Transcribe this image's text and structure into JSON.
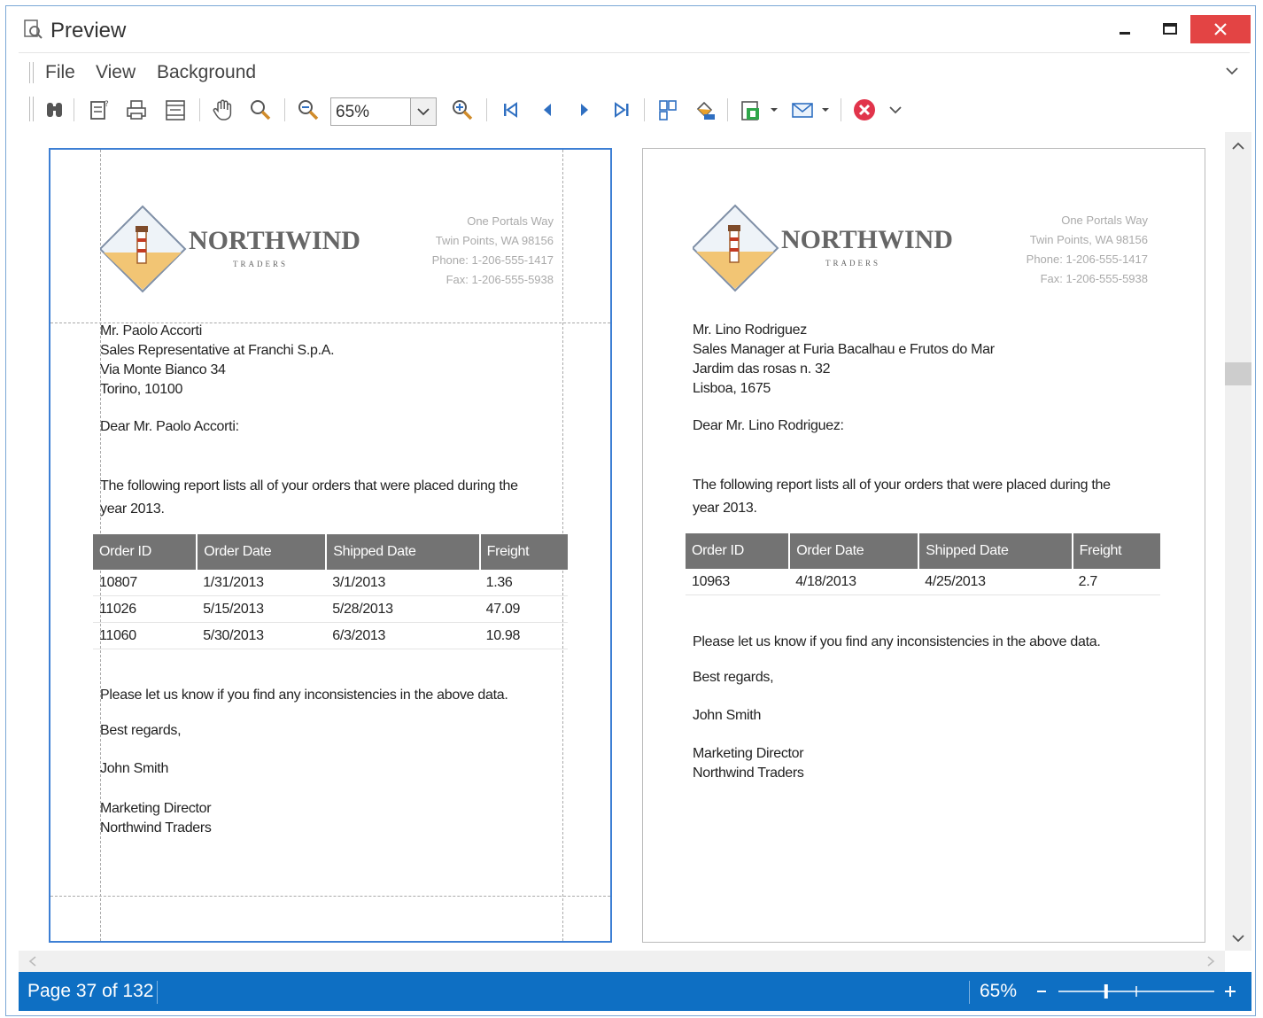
{
  "window": {
    "title": "Preview",
    "minimize_icon": "minimize-icon",
    "maximize_icon": "maximize-icon",
    "close_icon": "close-icon"
  },
  "menu": {
    "items": [
      {
        "label": "File"
      },
      {
        "label": "View"
      },
      {
        "label": "Background"
      }
    ]
  },
  "toolbar": {
    "zoom_value": "65%",
    "icons": [
      "find-icon",
      "open-icon",
      "print-icon",
      "page-setup-icon",
      "hand-tool-icon",
      "magnifier-icon",
      "zoom-out-icon",
      "zoom-in-icon",
      "first-page-icon",
      "previous-page-icon",
      "next-page-icon",
      "last-page-icon",
      "multiple-pages-icon",
      "background-color-icon",
      "export-icon",
      "send-email-icon",
      "close-preview-icon"
    ]
  },
  "pages": [
    {
      "company": {
        "name": "NORTHWIND",
        "tagline": "TRADERS"
      },
      "address": [
        "One Portals Way",
        "Twin Points, WA 98156",
        "Phone: 1-206-555-1417",
        "Fax: 1-206-555-5938"
      ],
      "recipient": [
        "Mr. Paolo Accorti",
        "Sales Representative at Franchi S.p.A.",
        "Via Monte Bianco 34",
        "Torino, 10100"
      ],
      "greeting": "Dear Mr. Paolo Accorti:",
      "intro": [
        "The following report lists all of your orders that were placed during the",
        "year 2013."
      ],
      "table": {
        "headers": [
          "Order ID",
          "Order Date",
          "Shipped Date",
          "Freight"
        ],
        "rows": [
          [
            "10807",
            "1/31/2013",
            "3/1/2013",
            "1.36"
          ],
          [
            "11026",
            "5/15/2013",
            "5/28/2013",
            "47.09"
          ],
          [
            "11060",
            "5/30/2013",
            "6/3/2013",
            "10.98"
          ]
        ]
      },
      "closing": "Please let us know if you find any inconsistencies in the above data.",
      "regards": "Best regards,",
      "signer": "John Smith",
      "signer_title": [
        "Marketing Director",
        "Northwind Traders"
      ]
    },
    {
      "company": {
        "name": "NORTHWIND",
        "tagline": "TRADERS"
      },
      "address": [
        "One Portals Way",
        "Twin Points, WA 98156",
        "Phone: 1-206-555-1417",
        "Fax: 1-206-555-5938"
      ],
      "recipient": [
        "Mr. Lino Rodriguez",
        "Sales Manager at Furia Bacalhau e Frutos do Mar",
        "Jardim das rosas n. 32",
        "Lisboa, 1675"
      ],
      "greeting": "Dear Mr. Lino Rodriguez:",
      "intro": [
        "The following report lists all of your orders that were placed during the",
        "year 2013."
      ],
      "table": {
        "headers": [
          "Order ID",
          "Order Date",
          "Shipped Date",
          "Freight"
        ],
        "rows": [
          [
            "10963",
            "4/18/2013",
            "4/25/2013",
            "2.7"
          ]
        ]
      },
      "closing": "Please let us know if you find any inconsistencies in the above data.",
      "regards": "Best regards,",
      "signer": "John Smith",
      "signer_title": [
        "Marketing Director",
        "Northwind Traders"
      ]
    }
  ],
  "status": {
    "page_label": "Page 37 of 132",
    "zoom_label": "65%",
    "zoom_level_percent": 65
  },
  "colors": {
    "statusbar": "#0e6fc3",
    "close_button": "#e34444",
    "table_header": "#737373",
    "selected_page_border": "#3d7fd4"
  }
}
